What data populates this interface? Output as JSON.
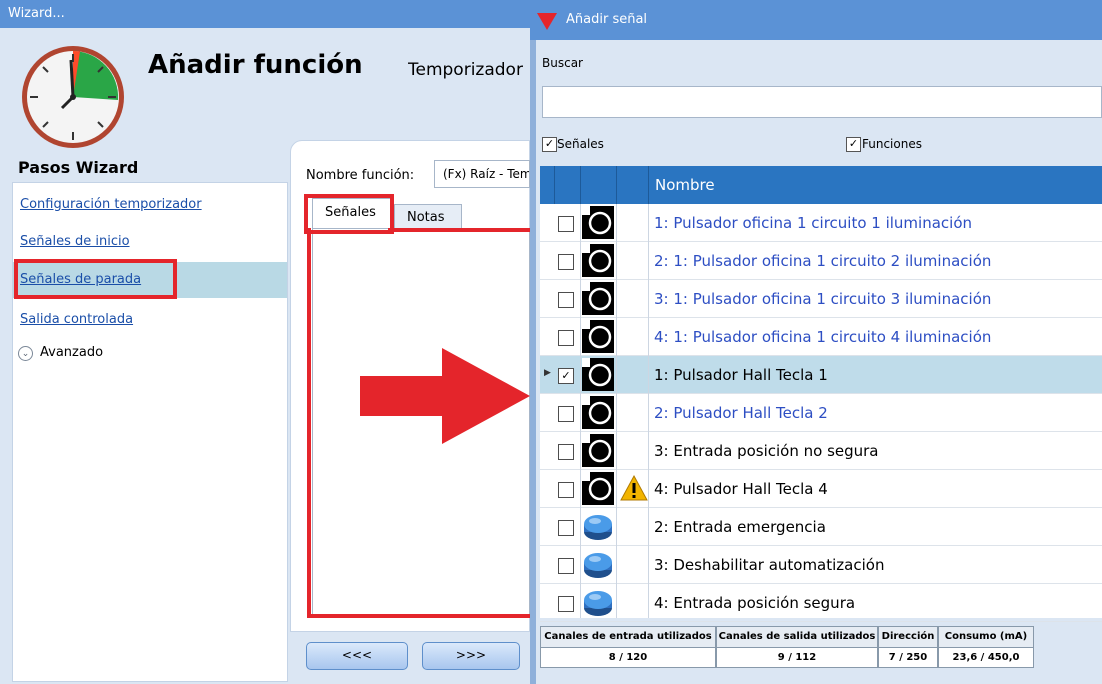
{
  "wizard": {
    "window_title": "Wizard...",
    "heading": "Añadir función",
    "subheading": "Temporizador",
    "steps_title": "Pasos Wizard",
    "steps": [
      {
        "label": "Configuración temporizador"
      },
      {
        "label": "Señales de inicio"
      },
      {
        "label": "Señales de parada",
        "selected": true
      },
      {
        "label": "Salida controlada"
      }
    ],
    "advanced_label": "Avanzado",
    "function_name_label": "Nombre función:",
    "function_name_value": "(Fx) Raíz - Temporizador",
    "tabs": [
      "Señales",
      "Notas"
    ],
    "back_button": "<<<",
    "next_button": ">>>",
    "highlight_color": "#e4252b"
  },
  "dialog": {
    "title": "Añadir señal",
    "search_label": "Buscar",
    "search_value": "",
    "filter_signals": {
      "label": "Señales",
      "checked": true
    },
    "filter_functions": {
      "label": "Funciones",
      "checked": true
    },
    "column_name": "Nombre",
    "rows": [
      {
        "name": "1: Pulsador oficina 1 circuito 1 iluminación",
        "icon": "pushbutton-icon",
        "link": true,
        "checked": false
      },
      {
        "name": "2: 1: Pulsador oficina 1 circuito 2 iluminación",
        "icon": "pushbutton-icon",
        "link": true,
        "checked": false
      },
      {
        "name": "3: 1: Pulsador oficina 1 circuito 3 iluminación",
        "icon": "pushbutton-icon",
        "link": true,
        "checked": false
      },
      {
        "name": "4: 1: Pulsador oficina 1 circuito 4 iluminación",
        "icon": "pushbutton-icon",
        "link": true,
        "checked": false
      },
      {
        "name": "1: Pulsador Hall Tecla 1",
        "icon": "pushbutton-icon",
        "link": false,
        "checked": true,
        "selected": true
      },
      {
        "name": "2: Pulsador Hall Tecla 2",
        "icon": "pushbutton-icon",
        "link": true,
        "checked": false
      },
      {
        "name": "3: Entrada posición no segura",
        "icon": "pushbutton-icon",
        "link": false,
        "checked": false
      },
      {
        "name": "4: Pulsador Hall Tecla 4",
        "icon": "pushbutton-icon",
        "link": false,
        "checked": false,
        "warning": true
      },
      {
        "name": "2: Entrada emergencia",
        "icon": "blue-button-icon",
        "link": false,
        "checked": false
      },
      {
        "name": "3: Deshabilitar automatización",
        "icon": "blue-button-icon",
        "link": false,
        "checked": false
      },
      {
        "name": "4: Entrada posición segura",
        "icon": "blue-button-icon",
        "link": false,
        "checked": false
      }
    ],
    "stats": [
      {
        "label": "Canales de entrada utilizados",
        "value": "8 / 120"
      },
      {
        "label": "Canales de salida utilizados",
        "value": "9 / 112"
      },
      {
        "label": "Dirección",
        "value": "7 / 250"
      },
      {
        "label": "Consumo (mA)",
        "value": "23,6 / 450,0"
      }
    ]
  }
}
